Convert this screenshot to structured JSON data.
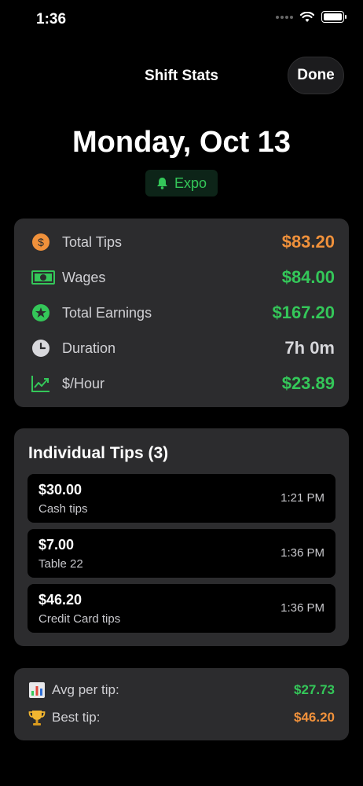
{
  "status_bar": {
    "time": "1:36"
  },
  "nav": {
    "title": "Shift Stats",
    "done_label": "Done"
  },
  "header": {
    "date": "Monday, Oct 13",
    "role": "Expo"
  },
  "stats": [
    {
      "label": "Total Tips",
      "value": "$83.20",
      "icon": "dollar-circle-icon",
      "color": "#f0913b"
    },
    {
      "label": "Wages",
      "value": "$84.00",
      "icon": "banknote-icon",
      "color": "#34c759"
    },
    {
      "label": "Total Earnings",
      "value": "$167.20",
      "icon": "star-circle-icon",
      "color": "#34c759"
    },
    {
      "label": "Duration",
      "value": "7h 0m",
      "icon": "clock-icon",
      "color": "#d8d8dc"
    },
    {
      "label": "$/Hour",
      "value": "$23.89",
      "icon": "trend-up-icon",
      "color": "#34c759"
    }
  ],
  "tips": {
    "title": "Individual Tips (3)",
    "items": [
      {
        "amount": "$30.00",
        "note": "Cash tips",
        "time": "1:21 PM"
      },
      {
        "amount": "$7.00",
        "note": "Table 22",
        "time": "1:36 PM"
      },
      {
        "amount": "$46.20",
        "note": "Credit Card tips",
        "time": "1:36 PM"
      }
    ]
  },
  "summary": {
    "avg_label": "Avg per tip:",
    "avg_value": "$27.73",
    "best_label": "Best tip:",
    "best_value": "$46.20"
  }
}
